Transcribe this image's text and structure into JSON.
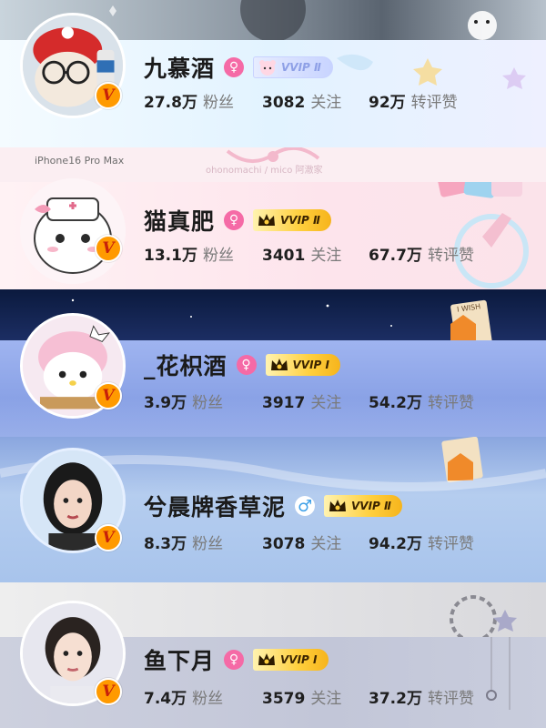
{
  "colors": {
    "card1_bg": "#e8f6ff",
    "card2_bg": "#fde9ef",
    "card3_bg": "#8fa6e8",
    "card4_bg": "#a9c8ee",
    "card5_bg": "#c9cdde",
    "vip_badge": "#ff9a00",
    "female": "#f56aa6",
    "male": "#3ea0e8"
  },
  "decor": {
    "phone_model": "iPhone16 Pro Max",
    "card2_watermark": "ohonomachi / mico 阿澈家",
    "wish_text": "I WISH"
  },
  "users": [
    {
      "name": "九慕酒",
      "gender": "female",
      "gender_symbol": "♀",
      "vvip_label": "VVIP Ⅱ",
      "vvip_style": "pastel",
      "verified_badge": "V",
      "avatar_icon": "red-hat-glasses-avatar",
      "followers": "27.8万",
      "followers_label": "粉丝",
      "following": "3082",
      "following_label": "关注",
      "interactions": "92万",
      "interactions_label": "转评赞"
    },
    {
      "name": "猫真肥",
      "gender": "female",
      "gender_symbol": "♀",
      "vvip_label": "VVIP Ⅱ",
      "vvip_style": "gold",
      "verified_badge": "V",
      "avatar_icon": "nurse-cat-avatar",
      "followers": "13.1万",
      "followers_label": "粉丝",
      "following": "3401",
      "following_label": "关注",
      "interactions": "67.7万",
      "interactions_label": "转评赞"
    },
    {
      "name": "_花枳酒",
      "gender": "female",
      "gender_symbol": "♀",
      "vvip_label": "VVIP Ⅰ",
      "vvip_style": "gold",
      "verified_badge": "V",
      "avatar_icon": "melody-plush-avatar",
      "followers": "3.9万",
      "followers_label": "粉丝",
      "following": "3917",
      "following_label": "关注",
      "interactions": "54.2万",
      "interactions_label": "转评赞"
    },
    {
      "name": "兮晨牌香草泥",
      "gender": "male",
      "gender_symbol": "♂",
      "vvip_label": "VVIP Ⅱ",
      "vvip_style": "gold",
      "verified_badge": "V",
      "avatar_icon": "portrait-avatar",
      "followers": "8.3万",
      "followers_label": "粉丝",
      "following": "3078",
      "following_label": "关注",
      "interactions": "94.2万",
      "interactions_label": "转评赞"
    },
    {
      "name": "鱼下月",
      "gender": "female",
      "gender_symbol": "♀",
      "vvip_label": "VVIP Ⅰ",
      "vvip_style": "gold",
      "verified_badge": "V",
      "avatar_icon": "portrait-avatar",
      "followers": "7.4万",
      "followers_label": "粉丝",
      "following": "3579",
      "following_label": "关注",
      "interactions": "37.2万",
      "interactions_label": "转评赞"
    }
  ]
}
